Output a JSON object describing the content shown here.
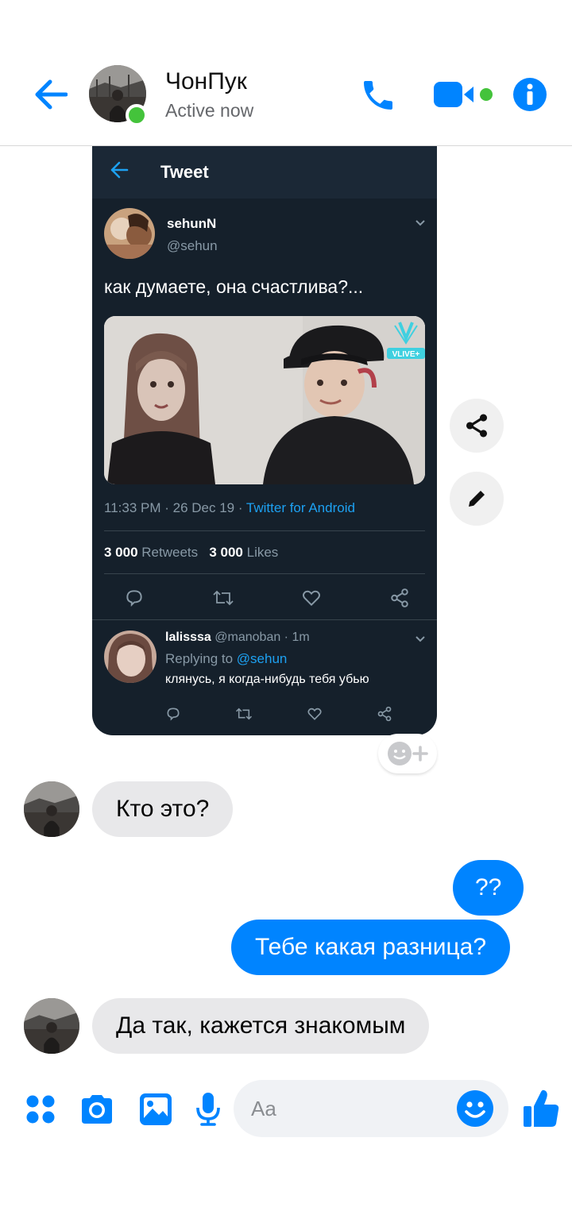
{
  "header": {
    "contact_name": "ЧонПук",
    "status": "Active now"
  },
  "shared_tweet": {
    "topbar_title": "Tweet",
    "author_name": "sehunN",
    "author_handle": "@sehun",
    "text": "как думаете, она счастлива?...",
    "media_badge": "VLIVE+",
    "meta_time": "11:33 PM · 26 Dec 19 · ",
    "meta_source": "Twitter for Android",
    "retweets_count": "3 000",
    "retweets_label": "Retweets",
    "likes_count": "3 000",
    "likes_label": "Likes",
    "reply": {
      "author_name": "lalisssa",
      "author_meta": " @manoban · 1m",
      "replying_prefix": "Replying to ",
      "replying_handle": "@sehun",
      "text": "клянусь, я когда-нибудь тебя убью"
    }
  },
  "messages": [
    {
      "direction": "in",
      "text": "Кто это?"
    },
    {
      "direction": "out",
      "text": "??"
    },
    {
      "direction": "out",
      "text": "Тебе какая разница?"
    },
    {
      "direction": "in",
      "text": "Да так, кажется знакомым"
    }
  ],
  "composer": {
    "placeholder": "Aa"
  },
  "colors": {
    "accent": "#0084ff",
    "online": "#44c33b",
    "incoming_bubble": "#e8e8ea",
    "tweet_bg": "#15202b",
    "twitter_blue": "#1da1f2"
  },
  "icons": [
    "back-arrow-icon",
    "phone-icon",
    "video-camera-icon",
    "info-icon",
    "share-icon",
    "pencil-icon",
    "add-reaction-icon",
    "apps-grid-icon",
    "camera-icon",
    "gallery-icon",
    "microphone-icon",
    "emoji-icon",
    "thumbs-up-icon"
  ]
}
